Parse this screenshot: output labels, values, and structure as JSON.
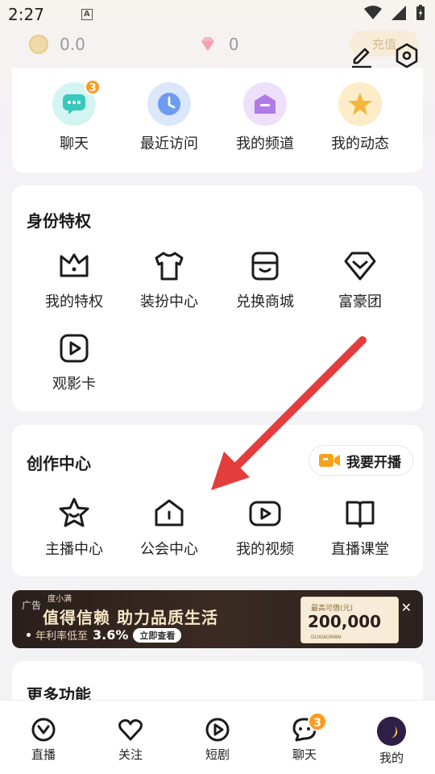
{
  "status_bar": {
    "time": "2:27"
  },
  "wallet": {
    "coins": "0.0",
    "gems": "0",
    "recharge_label": "充值"
  },
  "quick_actions": [
    {
      "label": "聊天",
      "icon": "chat-icon",
      "badge": "3",
      "color": "#4fd3c8"
    },
    {
      "label": "最近访问",
      "icon": "clock-icon",
      "color": "#6d9bf2"
    },
    {
      "label": "我的频道",
      "icon": "channel-icon",
      "color": "#b07ae8"
    },
    {
      "label": "我的动态",
      "icon": "star-icon",
      "color": "#f5b73b"
    }
  ],
  "identity": {
    "title": "身份特权",
    "items": [
      {
        "label": "我的特权",
        "icon": "crown-icon"
      },
      {
        "label": "装扮中心",
        "icon": "tshirt-icon"
      },
      {
        "label": "兑换商城",
        "icon": "store-icon"
      },
      {
        "label": "富豪团",
        "icon": "diamond-icon"
      },
      {
        "label": "观影卡",
        "icon": "play-card-icon"
      }
    ]
  },
  "creation": {
    "title": "创作中心",
    "live_button": "我要开播",
    "items": [
      {
        "label": "主播中心",
        "icon": "star-face-icon"
      },
      {
        "label": "公会中心",
        "icon": "house-icon"
      },
      {
        "label": "我的视频",
        "icon": "video-icon"
      },
      {
        "label": "直播课堂",
        "icon": "book-icon"
      }
    ]
  },
  "ad": {
    "tag": "广告",
    "brand": "度小满",
    "headline": "值得信赖  助力品质生活",
    "sub_prefix": "年利率低至",
    "rate": "3.6%",
    "cta": "立即查看",
    "card_caption": "最高可借(元)",
    "card_amount": "200,000",
    "card_en": "DUXIAOMAN"
  },
  "more": {
    "title": "更多功能"
  },
  "tabbar": [
    {
      "label": "直播",
      "icon": "live-tab-icon"
    },
    {
      "label": "关注",
      "icon": "heart-icon"
    },
    {
      "label": "短剧",
      "icon": "play-tab-icon"
    },
    {
      "label": "聊天",
      "icon": "chat-tab-icon",
      "badge": "3"
    },
    {
      "label": "我的",
      "icon": "avatar"
    }
  ],
  "colors": {
    "accent_orange": "#ff9a1f",
    "arrow_red": "#e43d3d",
    "live_icon": "#f7a21b"
  }
}
